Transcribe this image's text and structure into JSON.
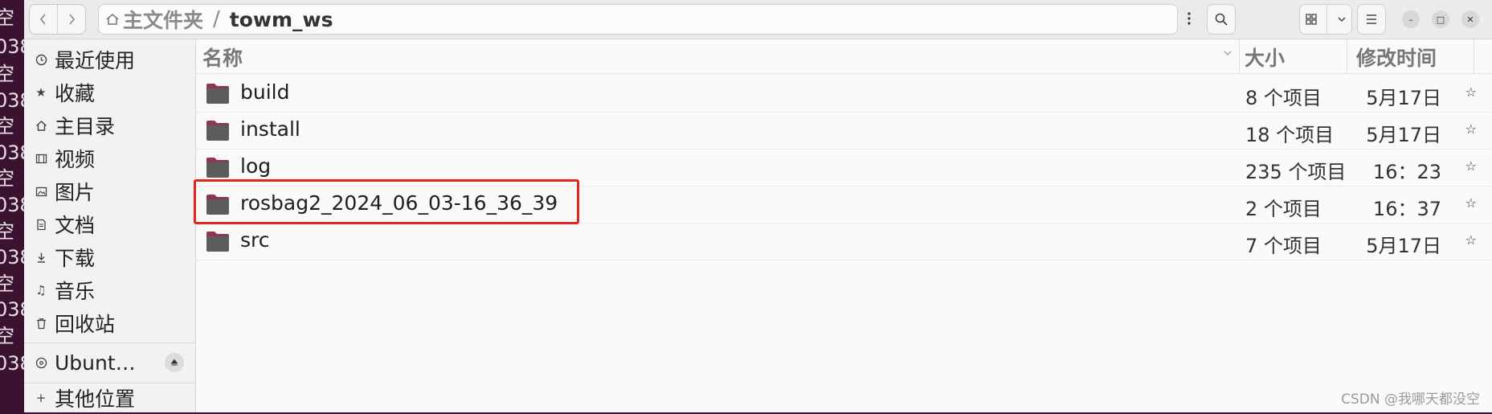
{
  "background_terminal": [
    "空",
    "038",
    "空",
    "038",
    "空",
    "038",
    "空",
    "038",
    "空",
    "038",
    "空",
    "038",
    "空",
    "038"
  ],
  "header": {
    "back_icon": "chevron-left-icon",
    "forward_icon": "chevron-right-icon",
    "path": {
      "home": "主文件夹",
      "separator": "/",
      "current": "towm_ws"
    },
    "menu_icon": "vertical-ellipsis-icon",
    "search_icon": "search-icon",
    "view_icon": "grid-view-icon",
    "view_dropdown_icon": "chevron-down-icon",
    "hamburger_icon": "hamburger-menu-icon",
    "window_controls": {
      "minimize": "–",
      "maximize": "□",
      "close": "✕"
    }
  },
  "sidebar": {
    "items": [
      {
        "label": "最近使用",
        "icon": "clock-icon"
      },
      {
        "label": "收藏",
        "icon": "star-icon"
      },
      {
        "label": "主目录",
        "icon": "home-icon"
      },
      {
        "label": "视频",
        "icon": "film-icon"
      },
      {
        "label": "图片",
        "icon": "image-icon"
      },
      {
        "label": "文档",
        "icon": "document-icon"
      },
      {
        "label": "下载",
        "icon": "download-icon"
      },
      {
        "label": "音乐",
        "icon": "music-icon"
      },
      {
        "label": "回收站",
        "icon": "trash-icon"
      }
    ],
    "device": {
      "label": "Ubunt…",
      "icon": "disc-icon",
      "eject_icon": "eject-icon"
    },
    "other": {
      "label": "其他位置",
      "icon": "plus-icon"
    }
  },
  "list": {
    "columns": {
      "name": "名称",
      "size": "大小",
      "modified": "修改时间"
    },
    "rows": [
      {
        "name": "build",
        "size": "8 个项目",
        "modified": "5月17日"
      },
      {
        "name": "install",
        "size": "18 个项目",
        "modified": "5月17日"
      },
      {
        "name": "log",
        "size": "235 个项目",
        "modified": "16：23"
      },
      {
        "name": "rosbag2_2024_06_03-16_36_39",
        "size": "2 个项目",
        "modified": "16：37",
        "highlighted": true
      },
      {
        "name": "src",
        "size": "7 个项目",
        "modified": "5月17日"
      }
    ],
    "star_glyph": "☆"
  },
  "colors": {
    "highlight_border": "#e6241f",
    "folder_dark": "#5c5c5c",
    "folder_tab": "#8b3a4e"
  },
  "watermark": "CSDN @我哪天都没空"
}
